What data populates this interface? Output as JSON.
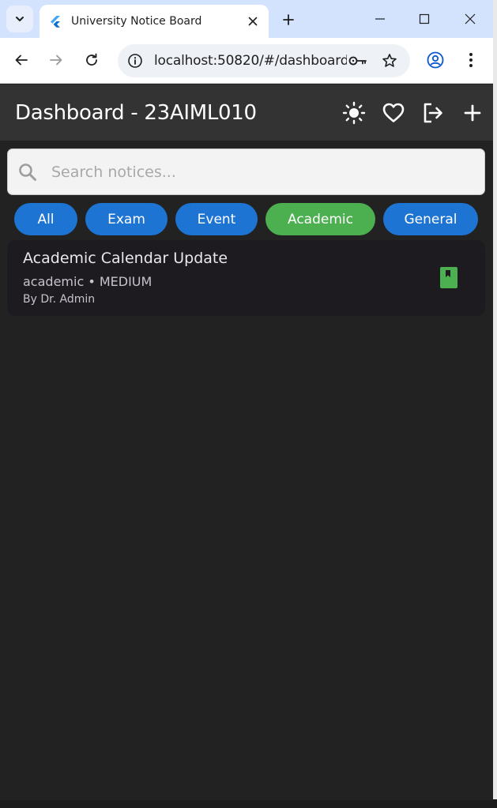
{
  "browser": {
    "tab_title": "University Notice Board",
    "url": "localhost:50820/#/dashboard"
  },
  "appbar": {
    "title": "Dashboard - 23AIML010",
    "actions": [
      "theme-toggle",
      "favorites",
      "logout",
      "add-notice"
    ]
  },
  "search": {
    "placeholder": "Search notices...",
    "value": ""
  },
  "filters": {
    "items": [
      {
        "label": "All",
        "active": false
      },
      {
        "label": "Exam",
        "active": false
      },
      {
        "label": "Event",
        "active": false
      },
      {
        "label": "Academic",
        "active": true
      },
      {
        "label": "General",
        "active": false
      }
    ]
  },
  "notices": [
    {
      "title": "Academic Calendar Update",
      "subtitle": "academic • MEDIUM",
      "author": "By Dr. Admin",
      "icon": "bookmark-icon",
      "icon_color": "#4caf50"
    }
  ],
  "colors": {
    "chip_default": "#1e74d2",
    "chip_active": "#4caf50",
    "appbar": "#333333",
    "background": "#222222"
  }
}
